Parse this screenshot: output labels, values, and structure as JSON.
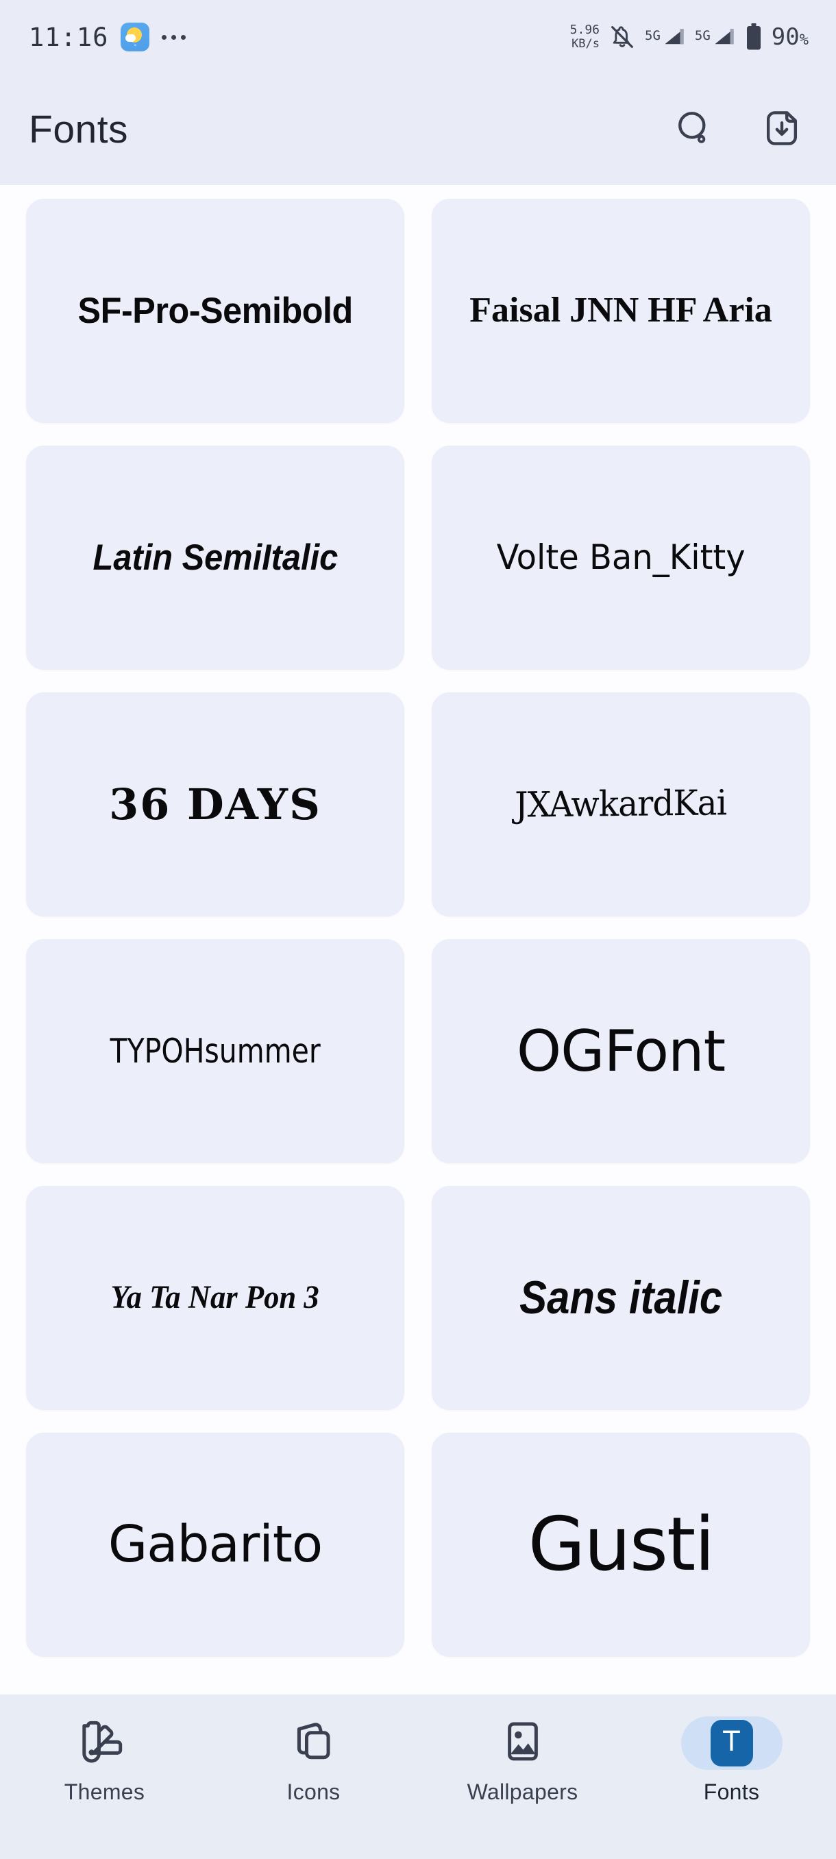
{
  "status_bar": {
    "time": "11:16",
    "weather_icon": "weather-sun-cloud-icon",
    "weather_degree": "°",
    "overflow_icon": "more-dots-icon",
    "net_speed_value": "5.96",
    "net_speed_unit": "KB/s",
    "mute_icon": "bell-muted-icon",
    "sim1_label": "5G",
    "sim2_label": "5G",
    "battery_icon": "battery-icon",
    "battery_percent": "90",
    "battery_percent_symbol": "%"
  },
  "header": {
    "title": "Fonts",
    "search_icon": "search-icon",
    "downloads_icon": "file-download-icon"
  },
  "fonts": {
    "items": [
      {
        "name": "SF-Pro-Semibold",
        "style_class": "s-sfpro"
      },
      {
        "name": "Faisal JNN HF Aria",
        "style_class": "s-faisal"
      },
      {
        "name": "Latin SemiItalic",
        "style_class": "s-latin"
      },
      {
        "name": "Volte Ban_Kitty",
        "style_class": "s-volte"
      },
      {
        "name": "36 DAYS",
        "style_class": "s-36days"
      },
      {
        "name": "JXAwkardKai",
        "style_class": "s-jx"
      },
      {
        "name": "TYPOHsummer",
        "style_class": "s-typoh"
      },
      {
        "name": "OGFont",
        "style_class": "s-ogfont"
      },
      {
        "name": "Ya Ta Nar Pon 3",
        "style_class": "s-yatanar"
      },
      {
        "name": "Sans italic",
        "style_class": "s-sansital"
      },
      {
        "name": "Gabarito",
        "style_class": "s-gabarito"
      },
      {
        "name": "Gusti",
        "style_class": "s-gusti"
      }
    ]
  },
  "bottom_nav": {
    "active": "Fonts",
    "items": [
      {
        "label": "Themes",
        "icon": "palette-swatch-icon",
        "active": false
      },
      {
        "label": "Icons",
        "icon": "stacked-cards-icon",
        "active": false
      },
      {
        "label": "Wallpapers",
        "icon": "image-picture-icon",
        "active": false
      },
      {
        "label": "Fonts",
        "icon": "font-t-icon",
        "active": true
      }
    ]
  },
  "colors": {
    "status_header_bg": "#e9ecf6",
    "page_bg": "#fdfdff",
    "card_bg": "#eceffa",
    "bottom_nav_bg": "#e8edf5",
    "active_pill": "#cfdff5",
    "active_icon": "#1565a8",
    "text_primary": "#22262f",
    "text_secondary": "#3a4050"
  }
}
